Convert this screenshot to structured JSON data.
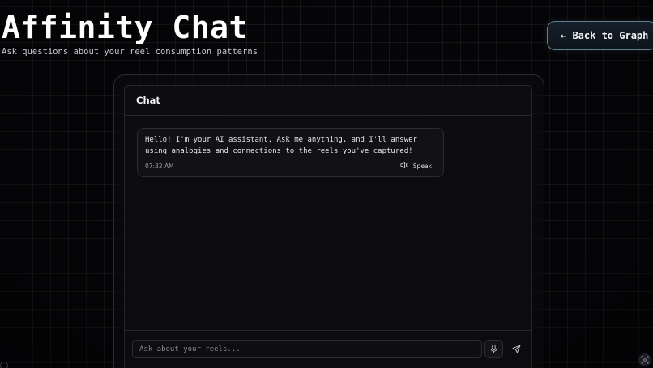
{
  "header": {
    "title": "Affinity Chat",
    "subtitle": "Ask questions about your reel consumption patterns",
    "back_label": "← Back to Graph"
  },
  "chat": {
    "title": "Chat",
    "messages": [
      {
        "text": "Hello! I'm your AI assistant. Ask me anything, and I'll answer using analogies and connections to the reels you've captured!",
        "time": "07:32 AM",
        "speak_label": "Speak"
      }
    ],
    "input": {
      "placeholder": "Ask about your reels...",
      "value": ""
    }
  },
  "icons": {
    "speak": "speaker-icon",
    "mic": "microphone-icon",
    "send": "send-icon",
    "corner": "scan-icon"
  },
  "colors": {
    "background": "#060508",
    "accent_border": "#5f7f8c",
    "text": "#e8e8ec"
  }
}
